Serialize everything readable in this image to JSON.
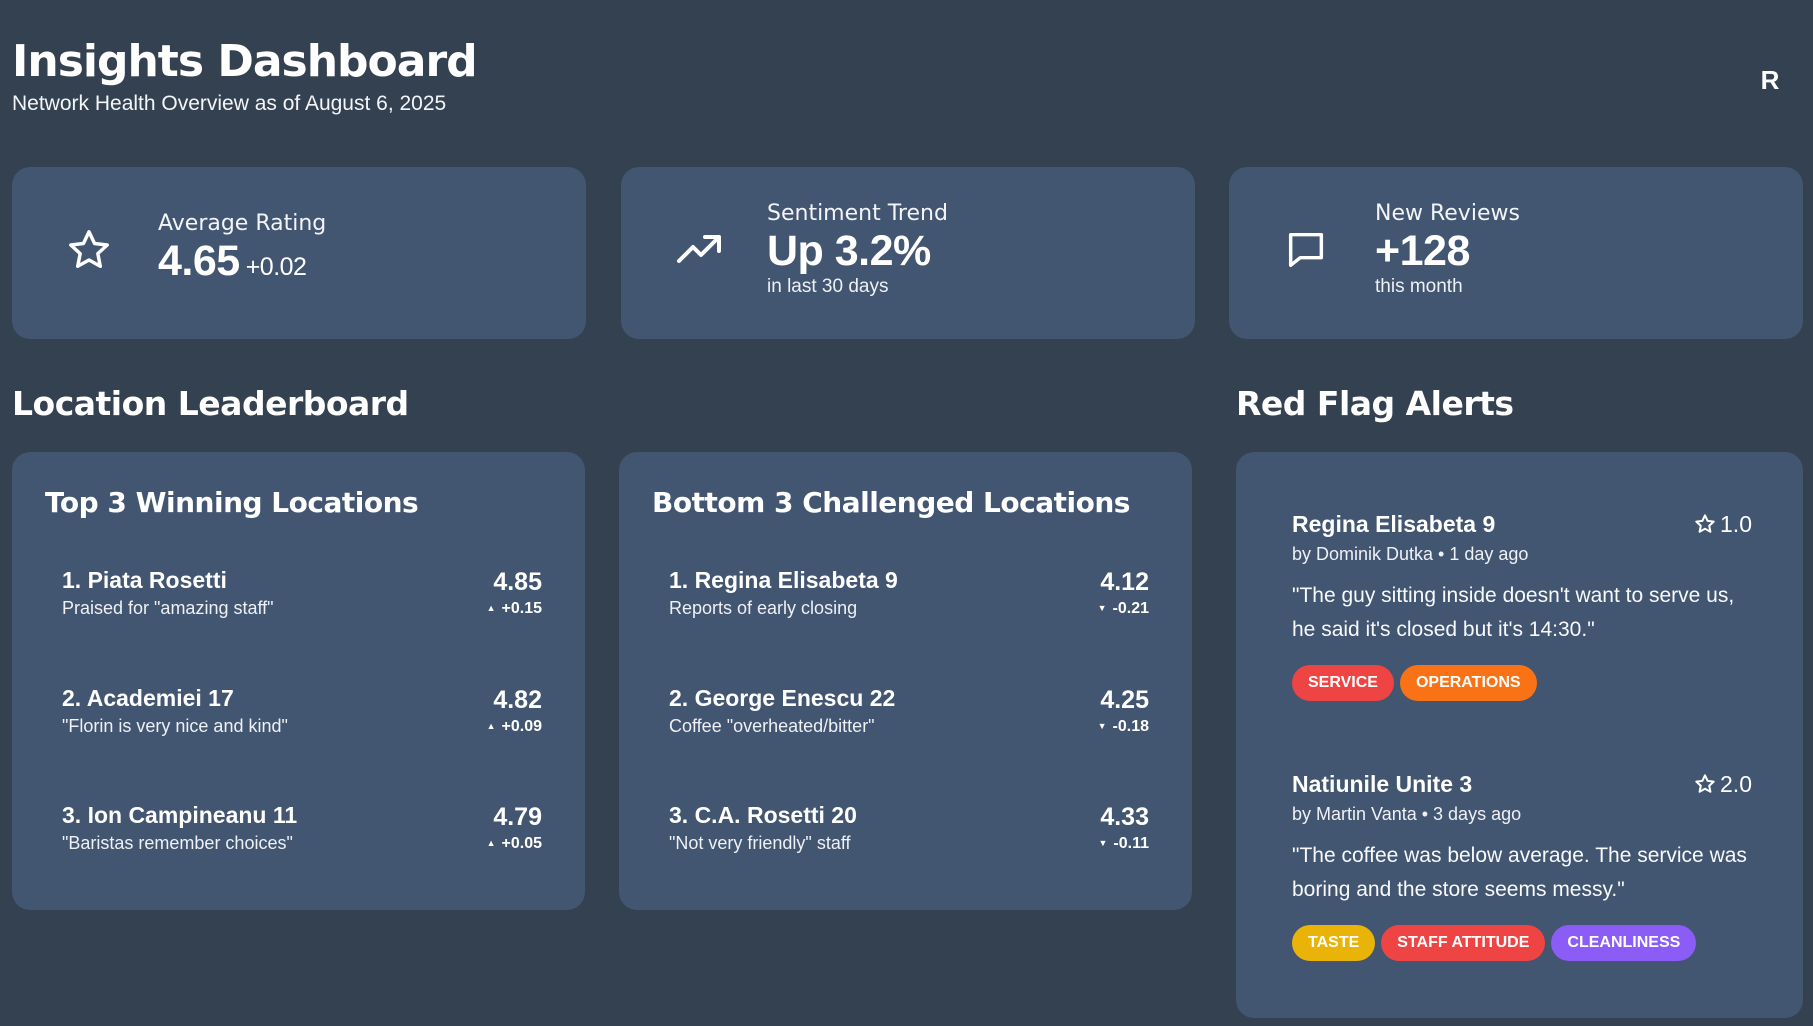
{
  "header": {
    "title": "Insights Dashboard",
    "subtitle": "Network Health Overview as of August 6, 2025",
    "avatar_initial": "R"
  },
  "stats": [
    {
      "icon": "star-icon",
      "label": "Average Rating",
      "value": "4.65",
      "delta": "+0.02",
      "sub": ""
    },
    {
      "icon": "trending-up-icon",
      "label": "Sentiment Trend",
      "value": "Up 3.2%",
      "delta": "",
      "sub": "in last 30 days"
    },
    {
      "icon": "message-icon",
      "label": "New Reviews",
      "value": "+128",
      "delta": "",
      "sub": "this month"
    }
  ],
  "leaderboard": {
    "title": "Location Leaderboard",
    "top": {
      "title": "Top 3 Winning Locations",
      "items": [
        {
          "name": "1. Piata Rosetti",
          "note": "Praised for \"amazing staff\"",
          "score": "4.85",
          "delta": "+0.15"
        },
        {
          "name": "2. Academiei 17",
          "note": "\"Florin is very nice and kind\"",
          "score": "4.82",
          "delta": "+0.09"
        },
        {
          "name": "3. Ion Campineanu 11",
          "note": "\"Baristas remember choices\"",
          "score": "4.79",
          "delta": "+0.05"
        }
      ]
    },
    "bottom": {
      "title": "Bottom 3 Challenged Locations",
      "items": [
        {
          "name": "1. Regina Elisabeta 9",
          "note": "Reports of early closing",
          "score": "4.12",
          "delta": "-0.21"
        },
        {
          "name": "2. George Enescu 22",
          "note": "Coffee \"overheated/bitter\"",
          "score": "4.25",
          "delta": "-0.18"
        },
        {
          "name": "3. C.A. Rosetti 20",
          "note": "\"Not very friendly\" staff",
          "score": "4.33",
          "delta": "-0.11"
        }
      ]
    }
  },
  "alerts": {
    "title": "Red Flag Alerts",
    "items": [
      {
        "location": "Regina Elisabeta 9",
        "rating": "1.0",
        "meta": "by Dominik Dutka • 1 day ago",
        "quote": "\"The guy sitting inside doesn't want to serve us, he said it's closed but it's 14:30.\"",
        "tags": [
          {
            "label": "SERVICE",
            "color": "#ef4444"
          },
          {
            "label": "OPERATIONS",
            "color": "#f97316"
          }
        ]
      },
      {
        "location": "Natiunile Unite 3",
        "rating": "2.0",
        "meta": "by Martin Vanta • 3 days ago",
        "quote": "\"The coffee was below average. The service was boring and the store seems messy.\"",
        "tags": [
          {
            "label": "TASTE",
            "color": "#eab308"
          },
          {
            "label": "STAFF ATTITUDE",
            "color": "#ef4444"
          },
          {
            "label": "CLEANLINESS",
            "color": "#8b5cf6"
          }
        ]
      }
    ]
  },
  "colors": {
    "background": "#334150",
    "card": "#425571"
  }
}
